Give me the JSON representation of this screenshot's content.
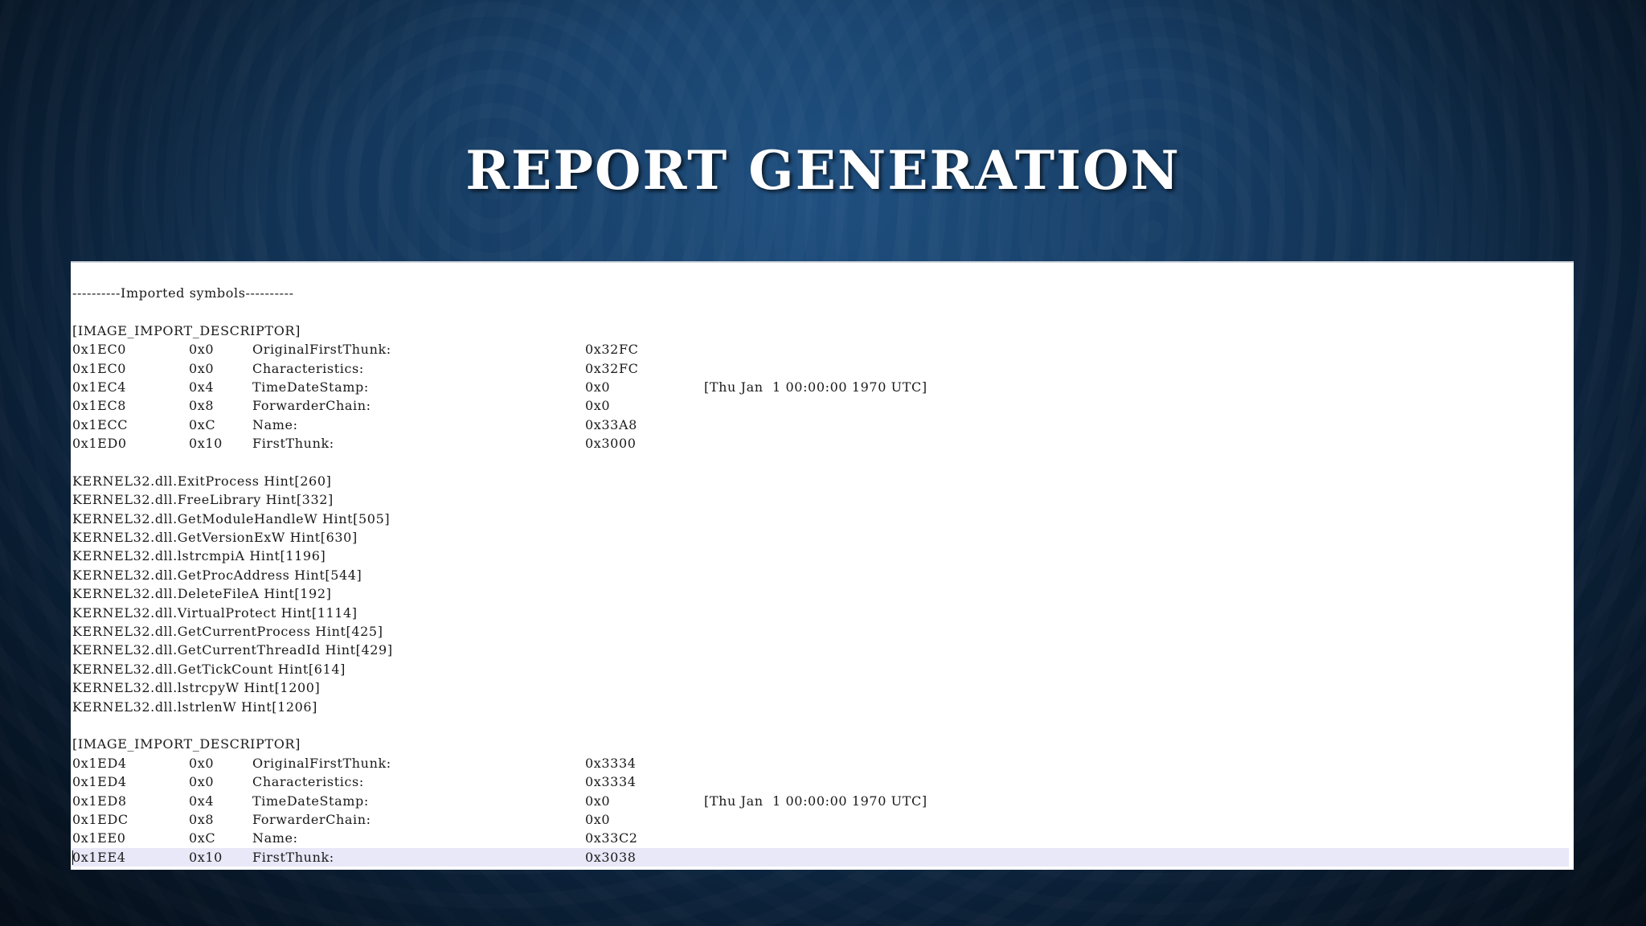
{
  "slide": {
    "title": "REPORT GENERATION"
  },
  "report": {
    "section_header": "----------Imported symbols----------",
    "descriptors": [
      {
        "label": "[IMAGE_IMPORT_DESCRIPTOR]",
        "rows": [
          {
            "offset": "0x1EC0",
            "rel": "0x0",
            "field": "OriginalFirstThunk:",
            "value": "0x32FC",
            "extra": ""
          },
          {
            "offset": "0x1EC0",
            "rel": "0x0",
            "field": "Characteristics:",
            "value": "0x32FC",
            "extra": ""
          },
          {
            "offset": "0x1EC4",
            "rel": "0x4",
            "field": "TimeDateStamp:",
            "value": "0x0",
            "extra": "[Thu Jan  1 00:00:00 1970 UTC]"
          },
          {
            "offset": "0x1EC8",
            "rel": "0x8",
            "field": "ForwarderChain:",
            "value": "0x0",
            "extra": ""
          },
          {
            "offset": "0x1ECC",
            "rel": "0xC",
            "field": "Name:",
            "value": "0x33A8",
            "extra": ""
          },
          {
            "offset": "0x1ED0",
            "rel": "0x10",
            "field": "FirstThunk:",
            "value": "0x3000",
            "extra": ""
          }
        ]
      },
      {
        "label": "[IMAGE_IMPORT_DESCRIPTOR]",
        "rows": [
          {
            "offset": "0x1ED4",
            "rel": "0x0",
            "field": "OriginalFirstThunk:",
            "value": "0x3334",
            "extra": ""
          },
          {
            "offset": "0x1ED4",
            "rel": "0x0",
            "field": "Characteristics:",
            "value": "0x3334",
            "extra": ""
          },
          {
            "offset": "0x1ED8",
            "rel": "0x4",
            "field": "TimeDateStamp:",
            "value": "0x0",
            "extra": "[Thu Jan  1 00:00:00 1970 UTC]"
          },
          {
            "offset": "0x1EDC",
            "rel": "0x8",
            "field": "ForwarderChain:",
            "value": "0x0",
            "extra": ""
          },
          {
            "offset": "0x1EE0",
            "rel": "0xC",
            "field": "Name:",
            "value": "0x33C2",
            "extra": ""
          },
          {
            "offset": "0x1EE4",
            "rel": "0x10",
            "field": "FirstThunk:",
            "value": "0x3038",
            "extra": ""
          }
        ]
      }
    ],
    "imports": [
      "KERNEL32.dll.ExitProcess Hint[260]",
      "KERNEL32.dll.FreeLibrary Hint[332]",
      "KERNEL32.dll.GetModuleHandleW Hint[505]",
      "KERNEL32.dll.GetVersionExW Hint[630]",
      "KERNEL32.dll.lstrcmpiA Hint[1196]",
      "KERNEL32.dll.GetProcAddress Hint[544]",
      "KERNEL32.dll.DeleteFileA Hint[192]",
      "KERNEL32.dll.VirtualProtect Hint[1114]",
      "KERNEL32.dll.GetCurrentProcess Hint[425]",
      "KERNEL32.dll.GetCurrentThreadId Hint[429]",
      "KERNEL32.dll.GetTickCount Hint[614]",
      "KERNEL32.dll.lstrcpyW Hint[1200]",
      "KERNEL32.dll.lstrlenW Hint[1206]"
    ]
  }
}
